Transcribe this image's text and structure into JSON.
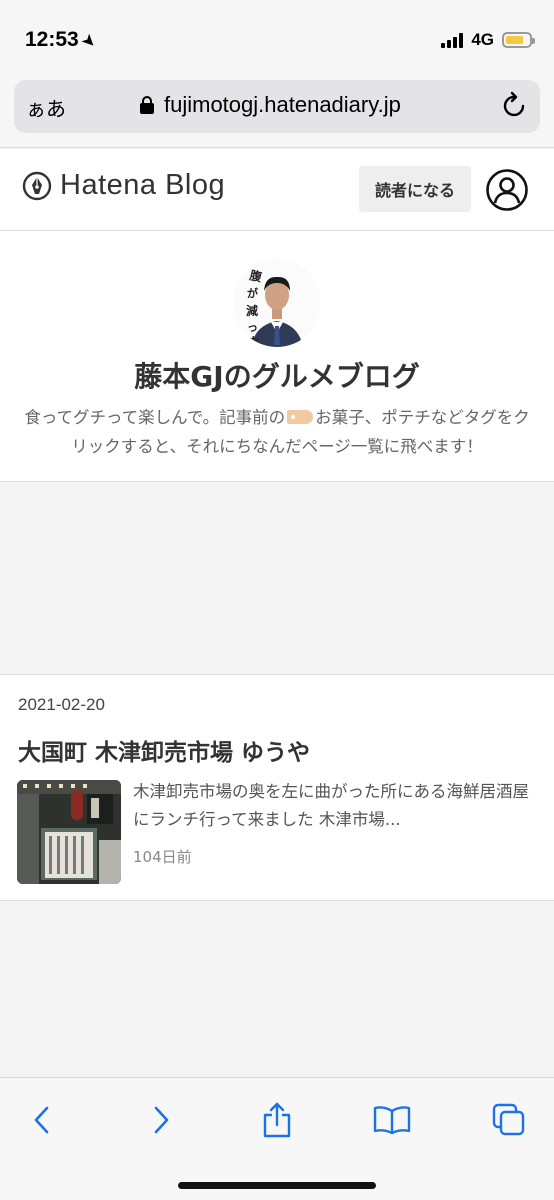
{
  "status_bar": {
    "time": "12:53",
    "network": "4G",
    "battery_level": 0.75,
    "battery_color": "#f5c842"
  },
  "browser": {
    "text_size_label": "ぁあ",
    "url": "fujimotogj.hatenadiary.jp",
    "accent_color": "#1a73e8"
  },
  "header": {
    "logo_text": "Hatena Blog",
    "subscribe_label": "読者になる"
  },
  "blog": {
    "title": "藤本GJのグルメブログ",
    "description_before_tag": "食ってグチって楽しんで。記事前の",
    "description_after_tag": "お菓子、ポテチなどタグをクリックすると、それにちなんだページ一覧に飛べます！",
    "avatar_calligraphy": "腹が減った"
  },
  "entry": {
    "date": "2021-02-20",
    "title": "大国町 木津卸売市場 ゆうや",
    "excerpt": "木津卸売市場の奥を左に曲がった所にある海鮮居酒屋にランチ行って来ました 木津市場...",
    "age": "104日前"
  },
  "toolbar": {
    "icons": [
      "back-icon",
      "forward-icon",
      "share-icon",
      "bookmarks-icon",
      "tabs-icon"
    ]
  }
}
